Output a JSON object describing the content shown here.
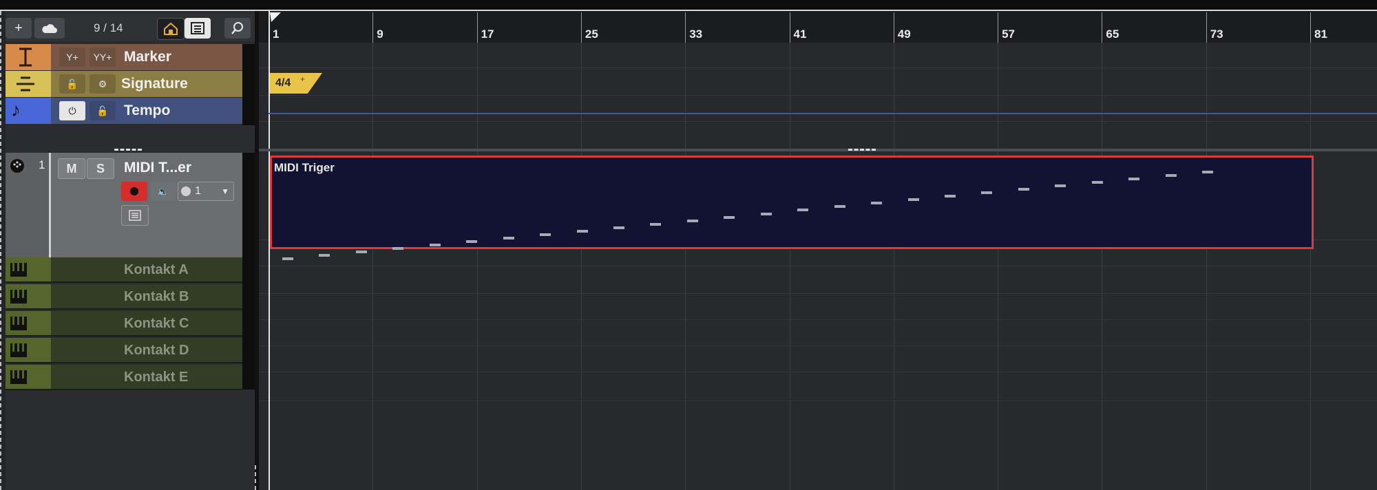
{
  "toolbar": {
    "add_icon": "plus-icon",
    "add_folder_icon": "cloud-add-icon",
    "counter": "9 / 14",
    "home_icon": "home-icon",
    "list_icon": "list-icon",
    "search_icon": "search-icon"
  },
  "tracks": {
    "marker": {
      "name": "Marker",
      "color": "#d88a4a"
    },
    "signature": {
      "name": "Signature",
      "color": "#d8c257"
    },
    "tempo": {
      "name": "Tempo",
      "color": "#4a67d8"
    },
    "midi": {
      "number": "1",
      "m": "M",
      "s": "S",
      "name": "MIDI T...er",
      "channel": "1"
    },
    "instruments": [
      "Kontakt A",
      "Kontakt B",
      "Kontakt C",
      "Kontakt D",
      "Kontakt E"
    ]
  },
  "ruler": {
    "bars": [
      "1",
      "9",
      "17",
      "25",
      "33",
      "41",
      "49",
      "57",
      "65",
      "73",
      "81"
    ]
  },
  "arrange": {
    "time_signature": "4/4",
    "part_title": "MIDI Triger",
    "notes": [
      0,
      1,
      2,
      3,
      4,
      5,
      6,
      7,
      8,
      9,
      10,
      11,
      12,
      13,
      14,
      15,
      16,
      17,
      18,
      19,
      20,
      21,
      22,
      23,
      24,
      25
    ]
  },
  "colors": {
    "part_border": "#d83c3c",
    "part_fill": "#121333",
    "record": "#d62c2c"
  }
}
